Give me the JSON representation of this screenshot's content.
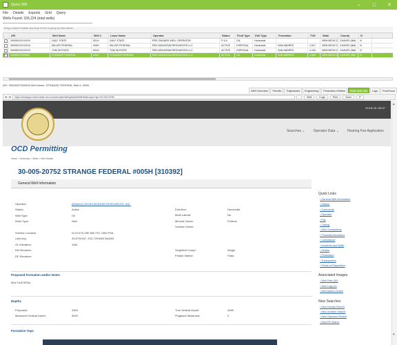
{
  "window": {
    "title": "Query 900",
    "min": "–",
    "max": "□",
    "close": "✕"
  },
  "menu": [
    "File",
    "Details",
    "Exports",
    "Grid",
    "Query"
  ],
  "wells_found": "Wells Found: 155,224 (total wells)",
  "group_hint": "Drag a column header and drop it here to group by that column",
  "grid": {
    "headers": [
      "API",
      "Well Name",
      "Well #",
      "Lease Name",
      "Operator",
      "Status",
      "Fluid Type",
      "Drill Type",
      "Formation",
      "TVD",
      "State",
      "County",
      "N"
    ],
    "rows": [
      [
        "30005XXXXXXXX",
        "GULF STATE",
        "001H",
        "GULF STATE",
        "PRE-ONGARD WELL OPERATOR",
        "P & A",
        "OIL",
        "Horizontal",
        "",
        "",
        "NEW MEXICO",
        "CHAVES (NM)",
        "N"
      ],
      [
        "30005XXXXXXXX",
        "MILLER FEDERAL",
        "006H",
        "MILLER FEDERAL",
        "RED MOUNTAIN RESOURCES LLC",
        "ACTIVE",
        "DISPOSAL",
        "Horizontal",
        "SAN ANDRES",
        "2,917",
        "NEW MEXICO",
        "CHAVES (NM)",
        "N"
      ],
      [
        "30005XXXXXXXX",
        "TOM 36 STATE",
        "001H",
        "TOM 36 STATE",
        "RED MOUNTAIN RESOURCES LLC",
        "ACTIVE",
        "DISPOSAL",
        "Horizontal",
        "SAN ANDRES",
        "4,118",
        "NEW MEXICO",
        "CHAVES (NM)",
        "N"
      ],
      [
        "30005207520000",
        "STRANGE FEDERAL",
        "005H",
        "STRANGE FEDERAL",
        "RED MOUNTAIN RESOURCES LLC",
        "ACTIVE",
        "OIL",
        "Horizontal",
        "SAN ANDRES",
        "4,065",
        "NEW MEXICO",
        "CHAVES (NM)",
        "N"
      ]
    ]
  },
  "detail_line": "API: 30005207520000  Well Name: STRANGE FEDERAL  Well #: 005H",
  "tabs": [
    "Well Overview",
    "Permits",
    "Trajectories",
    "Engineering",
    "Production Entities",
    "State Well Site",
    "Logs",
    "FracFocus"
  ],
  "active_tab_index": 5,
  "browser": {
    "url": "https://wwwapps.emnrd.state.nm.us/ocd/ocdpermitting/Data/WellDetails.aspx?api=30-005-20752",
    "buttons": [
      "Well",
      "Logs",
      "Print",
      "Docs",
      "P"
    ]
  },
  "site": {
    "header_links": "SIGN IN   HELP",
    "nav": [
      "Searches ⌄",
      "Operator Data ⌄",
      "Hearing Fee Application"
    ],
    "title": "OCD Permitting",
    "breadcrumb": "Home  >  Searches  >  Wells  >  Well Details",
    "well_title": "30-005-20752 STRANGE FEDERAL #005H [310392]",
    "gwi": "General Well Information",
    "fields_left": [
      [
        "Operator:",
        "[284814] CROSS BORDER RESOURCES, INC."
      ],
      [
        "Status:",
        "Active"
      ],
      [
        "Well Type:",
        "Oil"
      ],
      [
        "Work Type:",
        "New"
      ],
      [
        "",
        ""
      ],
      [
        "Surface Location:",
        "N-20-07S-29E    660 FSL    1980 FWL"
      ],
      [
        "Lat/Long:",
        "33.6734187,-103.7291689 NAD83"
      ],
      [
        "GL Elevation:",
        "4361"
      ],
      [
        "KB Elevation:",
        ""
      ],
      [
        "DF Elevation:",
        ""
      ]
    ],
    "fields_right": [
      [
        "Direction:",
        "Horizontal"
      ],
      [
        "Multi-Lateral:",
        "No"
      ],
      [
        "Mineral Owner:",
        "Federal"
      ],
      [
        "Surface Owner:",
        ""
      ],
      [
        "",
        ""
      ],
      [
        "",
        ""
      ],
      [
        "",
        ""
      ],
      [
        "Sing/Mult Compl:",
        "Single"
      ],
      [
        "Potash Waiver:",
        "False"
      ]
    ],
    "proposed_title": "Proposed Formation and/or Notes",
    "proposed_value": "MULTILATERAL",
    "depths_title": "Depths",
    "depths_left": [
      [
        "Proposed:",
        "4300"
      ],
      [
        "Measured Vertical Depth:",
        "5000"
      ]
    ],
    "depths_right": [
      [
        "True Vertical Depth:",
        "4065"
      ],
      [
        "Plugback Measured:",
        "0"
      ]
    ],
    "formation_tops_title": "Formation Tops",
    "quick_links_title": "Quick Links",
    "quick_links": [
      "General Well Information",
      "History",
      "Comments",
      "Operator",
      "Pits",
      "Casing",
      "Well Completions",
      "Financial Assurance",
      "Compliance",
      "Incidents and Spills",
      "Orders",
      "Production",
      "Transporters",
      "Points of Disposition"
    ],
    "associated_title": "Associated Images",
    "associated_links": [
      "Well Files (40)",
      "Well Logs (2)",
      "Well Admin Orders"
    ],
    "new_searches_title": "New Searches",
    "new_searches": [
      "New Facility Search",
      "New Incident Search",
      "New Operator Search",
      "New Pit Search"
    ]
  }
}
